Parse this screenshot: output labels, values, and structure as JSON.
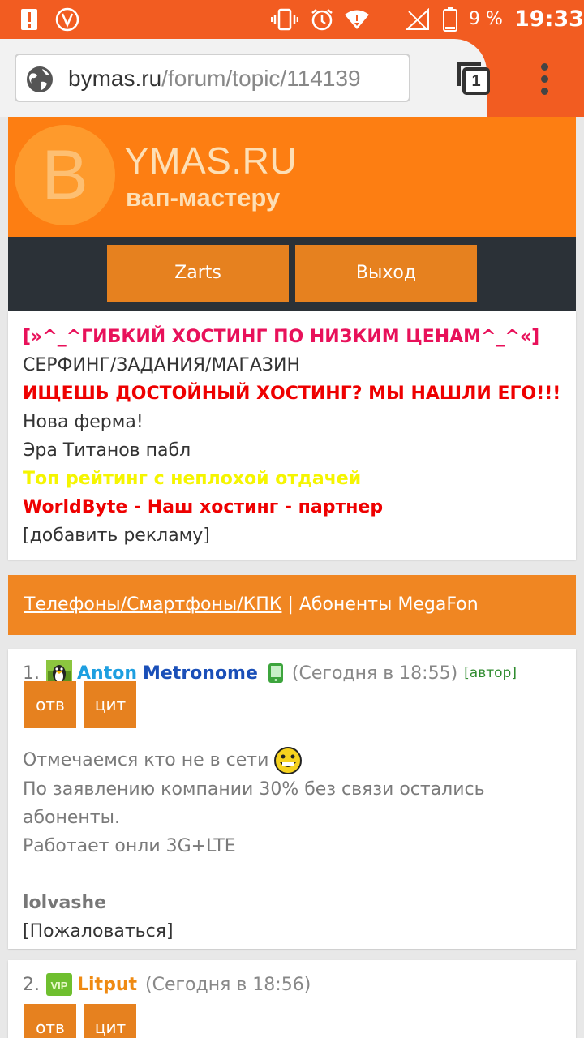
{
  "status_bar": {
    "battery_percent": "9 %",
    "time": "19:33",
    "icons": [
      "alert-icon",
      "v-app-icon",
      "vibrate-icon",
      "alarm-icon",
      "wifi-icon",
      "signal-icon",
      "battery-icon"
    ]
  },
  "browser": {
    "url_domain": "bymas.ru",
    "url_path": "/forum/topic/114139",
    "tabs_count": "1",
    "icons": [
      "globe-icon",
      "tabs-icon",
      "menu-icon"
    ]
  },
  "header": {
    "logo_letter": "B",
    "title": "YMAS.RU",
    "subtitle": "вап-мастеру",
    "colors": {
      "header_bg": "#fd7e12",
      "nav_bg": "#2b3137",
      "button_bg": "#e6811f"
    }
  },
  "nav": {
    "user_button": "Zarts",
    "logout_button": "Выход"
  },
  "ads": [
    {
      "text": "[»^_^ГИБКИЙ ХОСТИНГ ПО НИЗКИМ ЦЕНАМ^_^«]",
      "color": "#e8115a",
      "bold": true
    },
    {
      "text": "СЕРФИНГ/ЗАДАНИЯ/МАГАЗИН",
      "color": "#333333",
      "bold": false
    },
    {
      "text": "ИЩЕШЬ ДОСТОЙНЫЙ ХОСТИНГ? МЫ НАШЛИ ЕГО!!!",
      "color": "#ee0000",
      "bold": true
    },
    {
      "text": "Нова ферма!",
      "color": "#333333",
      "bold": false
    },
    {
      "text": "Эра Титанов пабл",
      "color": "#333333",
      "bold": false
    },
    {
      "text": "Топ рейтинг с неплохой отдачей",
      "color": "#f5f500",
      "bold": true
    },
    {
      "text": "WorldByte - Наш хостинг - партнер",
      "color": "#ee0000",
      "bold": true
    },
    {
      "text": "[добавить рекламу]",
      "color": "#333333",
      "bold": false
    }
  ],
  "topic": {
    "category": "Телефоны/Смартфоны/КПК",
    "separator": " | ",
    "title": "Абоненты MegaFon"
  },
  "posts": [
    {
      "number": "1.",
      "user_first": "Anton",
      "user_last": "Metronome",
      "time": "(Сегодня в 18:55)",
      "author_tag": "[автор]",
      "reply_label": "отв",
      "quote_label": "цит",
      "lines": [
        "Отмечаемся кто не в сети",
        "По заявлению компании 30% без связи остались абоненты.",
        "Работает онли 3G+LTE"
      ],
      "signature": "lolvashe",
      "report": "[Пожаловаться]"
    },
    {
      "number": "2.",
      "user": "Litput",
      "time": "(Сегодня в 18:56)",
      "reply_label": "отв",
      "quote_label": "цит"
    }
  ]
}
